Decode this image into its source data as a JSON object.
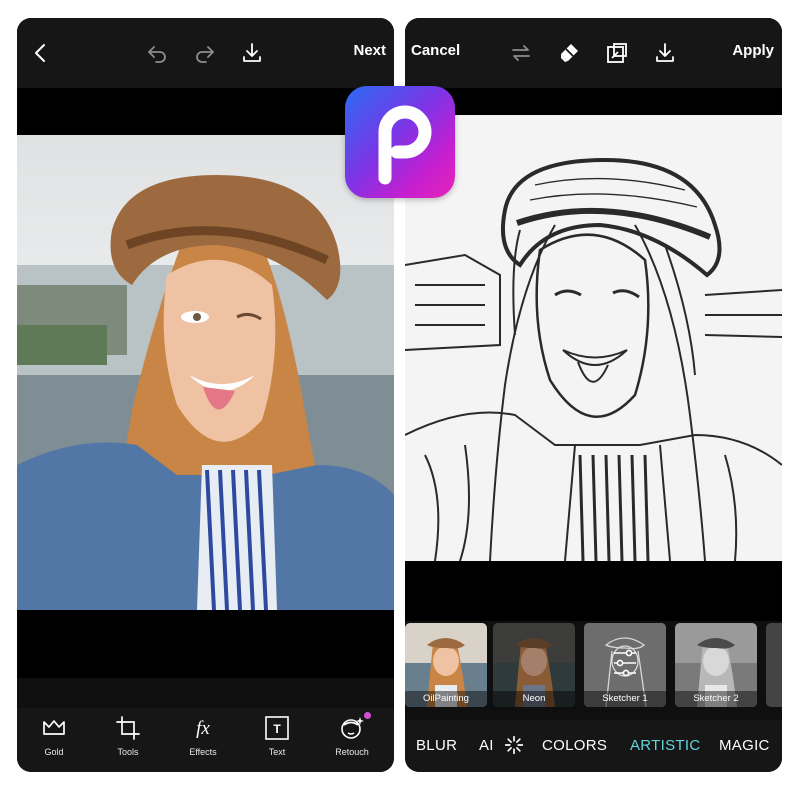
{
  "editor": {
    "next_label": "Next",
    "icons": {
      "back": "back-chevron-icon",
      "undo": "undo-icon",
      "redo": "redo-icon",
      "download": "download-icon"
    },
    "tools": [
      {
        "label": "Gold",
        "icon": "crown-icon"
      },
      {
        "label": "Tools",
        "icon": "crop-icon"
      },
      {
        "label": "Effects",
        "icon": "fx-icon",
        "glyph": "fx"
      },
      {
        "label": "Text",
        "icon": "text-icon",
        "glyph": "T"
      },
      {
        "label": "Retouch",
        "icon": "retouch-face-icon"
      }
    ],
    "retouch_badge_color": "#d04fd6"
  },
  "effects_screen": {
    "cancel_label": "Cancel",
    "apply_label": "Apply",
    "icons": {
      "swap": "swap-icon",
      "eraser": "eraser-icon",
      "compare": "compare-icon",
      "download": "download-icon"
    },
    "filters": [
      {
        "label": "OilPainting",
        "selected": false
      },
      {
        "label": "Neon",
        "selected": false
      },
      {
        "label": "Sketcher 1",
        "selected": true
      },
      {
        "label": "Sketcher 2",
        "selected": false
      }
    ],
    "categories": [
      {
        "label": "BLUR",
        "active": false
      },
      {
        "label": "AI",
        "active": false
      },
      {
        "label": "COLORS",
        "active": false
      },
      {
        "label": "ARTISTIC",
        "active": true
      },
      {
        "label": "MAGIC",
        "active": false
      }
    ],
    "accent_color": "#62d3d9"
  },
  "logo": {
    "glyph": "P",
    "gradient": [
      "#2b6cf4",
      "#7b35e6",
      "#e724b8"
    ]
  }
}
